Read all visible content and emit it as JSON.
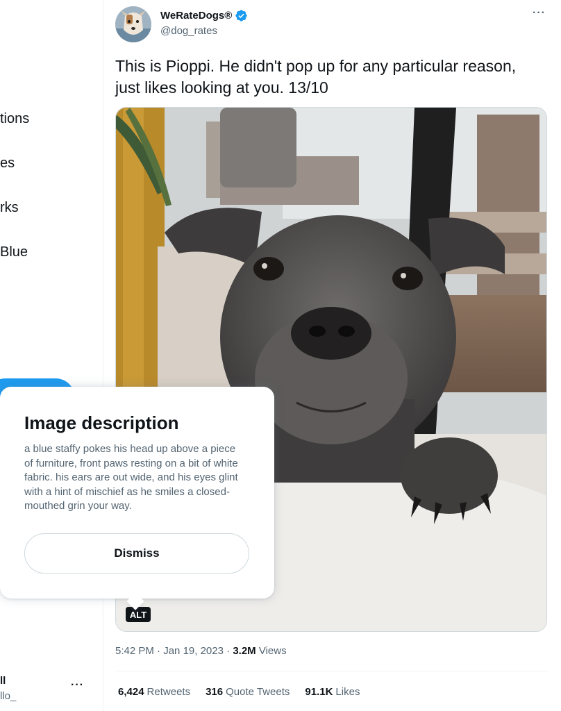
{
  "sidebar": {
    "nav_items": [
      {
        "label": "tions"
      },
      {
        "label": "es"
      },
      {
        "label": "rks"
      },
      {
        "label": "Blue"
      }
    ],
    "account": {
      "name": "ll",
      "handle": "llo_",
      "more": "···"
    }
  },
  "tweet": {
    "author": {
      "name": "WeRateDogs®",
      "handle": "@dog_rates",
      "verified": true
    },
    "more": "···",
    "text": "This is Pioppi. He didn't pop up for any particular reason, just likes looking at you. 13/10",
    "media": {
      "alt_badge": "ALT"
    },
    "meta": {
      "time": "5:42 PM",
      "sep": " · ",
      "date": "Jan 19, 2023",
      "views_count": "3.2M",
      "views_label": " Views"
    },
    "stats": [
      {
        "count": "6,424",
        "label": "Retweets"
      },
      {
        "count": "316",
        "label": "Quote Tweets"
      },
      {
        "count": "91.1K",
        "label": "Likes"
      }
    ]
  },
  "popover": {
    "title": "Image description",
    "description": "a blue staffy pokes his head up above a piece of furniture, front paws resting on a bit of white fabric. his ears are out wide, and his eyes glint with a hint of mischief as he smiles a closed-mouthed grin your way.",
    "dismiss_label": "Dismiss"
  },
  "colors": {
    "accent": "#1d9bf0",
    "text_primary": "#0f1419",
    "text_secondary": "#536471"
  }
}
